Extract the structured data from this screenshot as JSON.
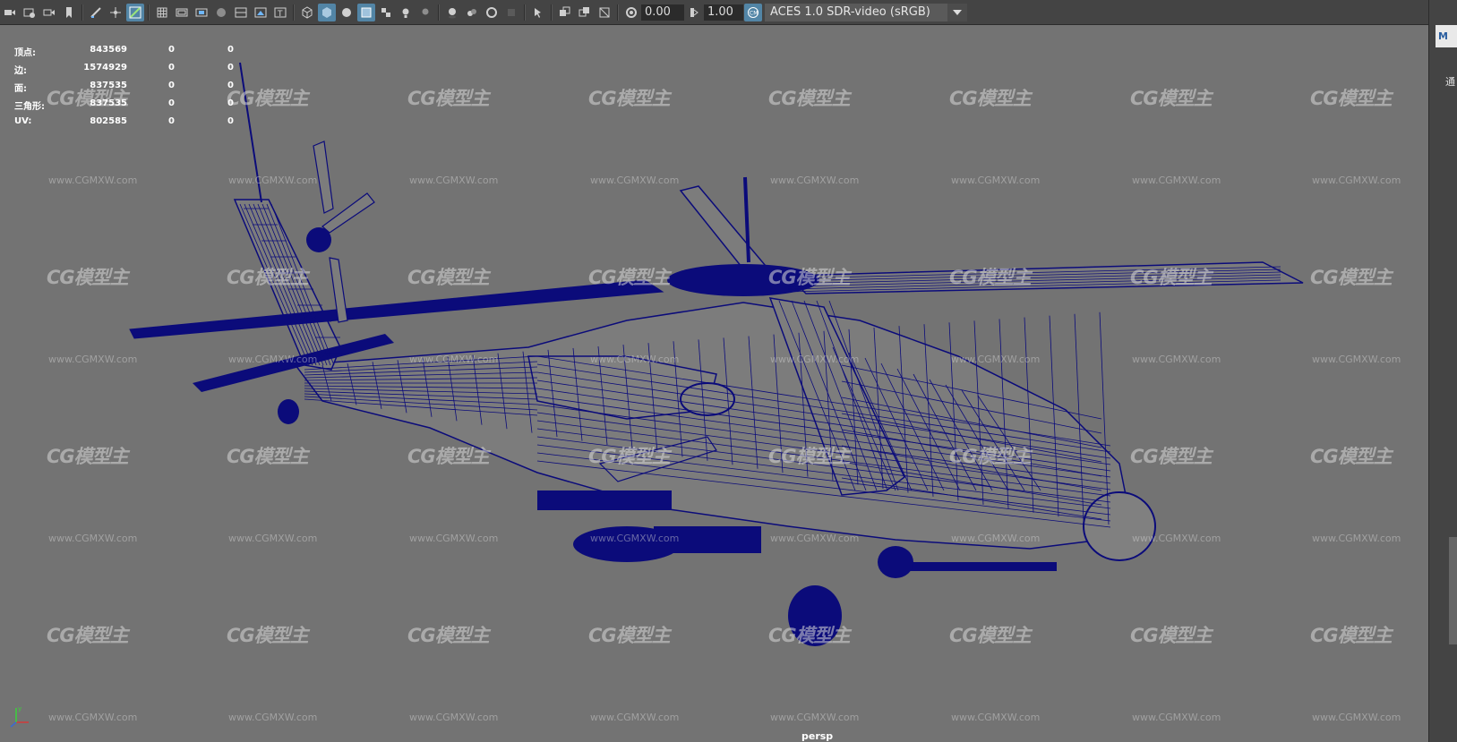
{
  "toolbar": {
    "exposure_value": "0.00",
    "gamma_value": "1.00",
    "color_space": "ACES 1.0 SDR-video (sRGB)",
    "icons_left": [
      "camera-icon",
      "image-plane-icon",
      "camera-attributes-icon",
      "bookmark-icon",
      "grease-pencil-icon",
      "move-icon",
      "paint-icon"
    ],
    "icons_mid": [
      "grid-icon",
      "film-gate-icon",
      "resolution-gate-icon",
      "gate-mask-icon",
      "field-chart-icon",
      "safe-action-icon",
      "safe-title-icon"
    ],
    "icons_shading": [
      "wireframe-icon",
      "smooth-shade-icon",
      "default-material-icon",
      "wireframe-on-shaded-icon",
      "xray-checker-icon",
      "lights-icon",
      "shadows-icon",
      "ambient-occlusion-icon",
      "motion-blur-icon",
      "anti-alias-icon",
      "depth-of-field-icon",
      "isolate-select-icon",
      "xray-icon",
      "xray-joints-icon",
      "xray-components-icon",
      "exposure-icon",
      "gamma-icon",
      "color-management-icon"
    ]
  },
  "hud": {
    "rows": [
      {
        "label": "顶点:",
        "v1": "843569",
        "v2": "0",
        "v3": "0"
      },
      {
        "label": "边:",
        "v1": "1574929",
        "v2": "0",
        "v3": "0"
      },
      {
        "label": "面:",
        "v1": "837535",
        "v2": "0",
        "v3": "0"
      },
      {
        "label": "三角形:",
        "v1": "837535",
        "v2": "0",
        "v3": "0"
      },
      {
        "label": "UV:",
        "v1": "802585",
        "v2": "0",
        "v3": "0"
      }
    ]
  },
  "watermark": {
    "logo": "CG模型主",
    "url": "www.CGMXW.com"
  },
  "viewport": {
    "camera_label": "persp",
    "background_color": "#737373",
    "wire_color": "#0b0b7a"
  },
  "right_panel": {
    "button_label": "M",
    "side_char": "通"
  }
}
